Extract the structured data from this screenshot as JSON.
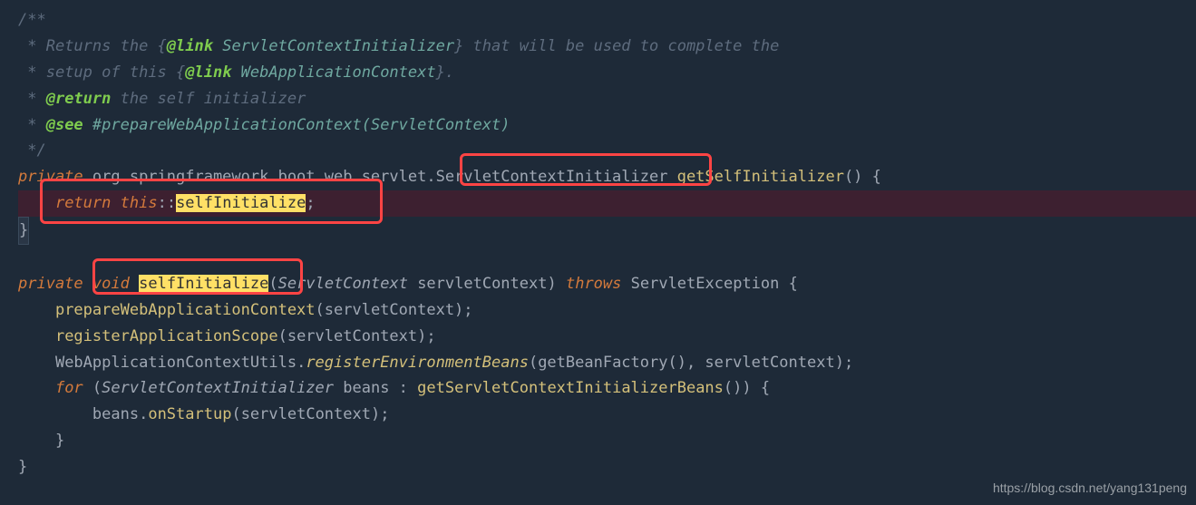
{
  "comment": {
    "l1": "/**",
    "l2_prefix": " * ",
    "l2_text1": "Returns the {",
    "l2_tag": "@link",
    "l2_link": " ServletContextInitializer",
    "l2_text2": "} that will be used to complete the",
    "l3_text1": "setup of this {",
    "l3_tag": "@link",
    "l3_link": " WebApplicationContext",
    "l3_text2": "}.",
    "l4_tag": "@return",
    "l4_text": " the self initializer",
    "l5_tag": "@see",
    "l5_link": " #prepareWebApplicationContext(ServletContext)",
    "l6": " */"
  },
  "line7": {
    "kw_private": "private",
    "pkg": " org.springframework.boot.web.servlet.",
    "type": "ServletContextInitializer",
    "method": " getSelfInitializer",
    "parens": "() {"
  },
  "line8": {
    "indent": "    ",
    "kw_return": "return",
    "sp": " ",
    "kw_this": "this",
    "dcolon": "::",
    "method": "selfInitialize",
    "semi": ";"
  },
  "line9": {
    "brace": "}"
  },
  "line11": {
    "kw_private": "private",
    "sp1": " ",
    "kw_void": "void",
    "sp2": " ",
    "method": "selfInitialize",
    "paren_open": "(",
    "param_type": "ServletContext",
    "param_name": " servletContext",
    "paren_close": ") ",
    "kw_throws": "throws",
    "exc": " ServletException {"
  },
  "line12": {
    "indent": "    ",
    "method": "prepareWebApplicationContext",
    "args": "(servletContext);"
  },
  "line13": {
    "indent": "    ",
    "method": "registerApplicationScope",
    "args": "(servletContext);"
  },
  "line14": {
    "indent": "    ",
    "cls": "WebApplicationContextUtils",
    "dot": ".",
    "method": "registerEnvironmentBeans",
    "args": "(getBeanFactory(), servletContext);"
  },
  "line15": {
    "indent": "    ",
    "kw_for": "for",
    "sp": " (",
    "type": "ServletContextInitializer",
    "var": " beans : ",
    "call": "getServletContextInitializerBeans",
    "rest": "()) {"
  },
  "line16": {
    "indent": "        ",
    "obj": "beans",
    "dot": ".",
    "method": "onStartup",
    "args": "(servletContext);"
  },
  "line17": {
    "indent": "    ",
    "brace": "}"
  },
  "line18": {
    "brace": "}"
  },
  "watermark": "https://blog.csdn.net/yang131peng"
}
